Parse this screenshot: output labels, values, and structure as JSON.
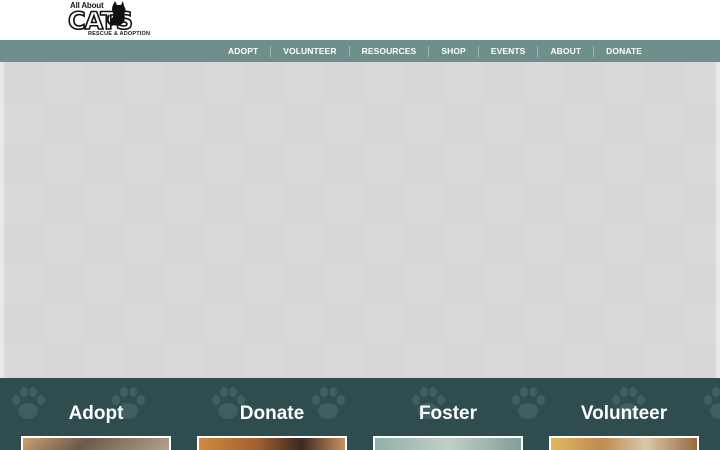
{
  "logo": {
    "line1": "All About",
    "wordmark": "CATS",
    "line3": "RESCUE & ADOPTION",
    "icon": "cat-silhouette-icon"
  },
  "nav": {
    "items": [
      "ADOPT",
      "VOLUNTEER",
      "RESOURCES",
      "SHOP",
      "EVENTS",
      "ABOUT",
      "DONATE"
    ]
  },
  "colors": {
    "nav_bg": "#6e8f8b",
    "band_bg": "#2f4d4f",
    "hero_bg": "#d9d7d6"
  },
  "cards": [
    {
      "title": "Adopt",
      "thumb_color": "#8a7a6a"
    },
    {
      "title": "Donate",
      "thumb_color": "#b47a4a"
    },
    {
      "title": "Foster",
      "thumb_color": "#9fb5b0"
    },
    {
      "title": "Volunteer",
      "thumb_color": "#c8a870"
    }
  ]
}
